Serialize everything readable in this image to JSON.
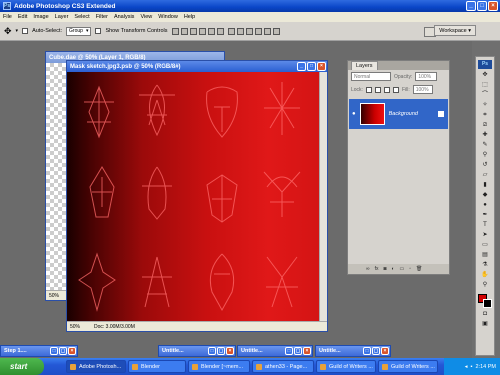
{
  "app": {
    "title": "Adobe Photoshop CS3 Extended",
    "badge": "Ps"
  },
  "menu": [
    "File",
    "Edit",
    "Image",
    "Layer",
    "Select",
    "Filter",
    "Analysis",
    "View",
    "Window",
    "Help"
  ],
  "options": {
    "auto_select_label": "Auto-Select:",
    "auto_select_value": "Group",
    "transform_label": "Show Transform Controls",
    "workspace_label": "Workspace"
  },
  "documents": {
    "back": {
      "title": "Cube.dae @ 50% (Layer 1, RGB/8)",
      "zoom": "50%"
    },
    "front": {
      "title": "Mask sketch.jpg3.psb @ 50% (RGB/8#)",
      "zoom": "50%",
      "doc_info": "Doc: 3.00M/3.00M"
    }
  },
  "layers_panel": {
    "tab": "Layers",
    "blend_mode": "Normal",
    "opacity_label": "Opacity:",
    "opacity_value": "100%",
    "lock_label": "Lock:",
    "fill_label": "Fill:",
    "fill_value": "100%",
    "layer_name": "Background"
  },
  "minimized": [
    {
      "title": "Step 1...."
    },
    {
      "title": "Untitle..."
    },
    {
      "title": "Untitle..."
    },
    {
      "title": "Untitle..."
    }
  ],
  "taskbar": {
    "start": "start",
    "items": [
      "Adobe Photosh...",
      "Blender",
      "Blender [~mem...",
      "athen33 - Page...",
      "Guild of Writers ...",
      "Guild of Writers ..."
    ],
    "clock": "2:14 PM"
  },
  "colors": {
    "accent": "#2b5fd2",
    "canvas": "#c81010"
  }
}
